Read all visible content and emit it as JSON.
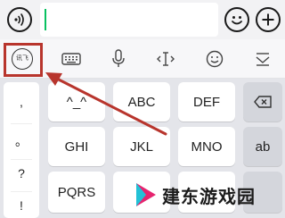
{
  "chat_bar": {
    "voice_icon": "voice-wave-icon",
    "input_value": "",
    "emoji_icon": "smiley-face-icon",
    "plus_icon": "plus-icon",
    "caret_color": "#08c160"
  },
  "toolbar": {
    "ime_logo_text": "讯飞",
    "highlight_color": "#b8352d",
    "tools": [
      "keyboard-icon",
      "microphone-icon",
      "text-cursor-icon",
      "emoji-icon",
      "collapse-keyboard-icon"
    ]
  },
  "keyboard": {
    "symbols": [
      ",",
      "。",
      "?",
      "!"
    ],
    "row1": {
      "k1": "^_^",
      "k2": "ABC",
      "k3": "DEF",
      "delete": "backspace-icon"
    },
    "row2": {
      "k1": "GHI",
      "k2": "JKL",
      "k3": "MNO",
      "k4": "ab"
    },
    "row3": {
      "k1": "PQRS"
    }
  },
  "watermark": {
    "text": "建东游戏园",
    "logo_colors": [
      "#e6246f",
      "#22c1d6"
    ]
  }
}
